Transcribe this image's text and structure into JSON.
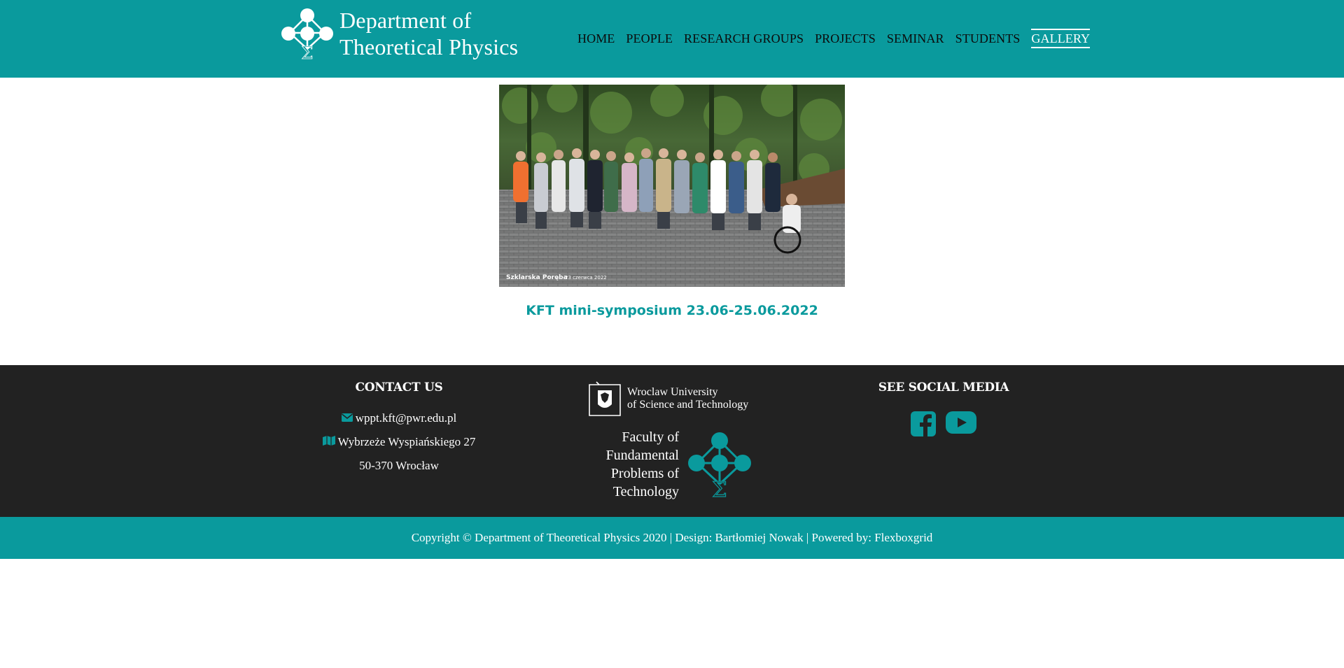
{
  "brand": {
    "line1": "Department of",
    "line2": "Theoretical Physics"
  },
  "nav": {
    "items": [
      {
        "label": "HOME"
      },
      {
        "label": "PEOPLE"
      },
      {
        "label": "RESEARCH GROUPS"
      },
      {
        "label": "PROJECTS"
      },
      {
        "label": "SEMINAR"
      },
      {
        "label": "STUDENTS"
      },
      {
        "label": "GALLERY"
      }
    ],
    "active": "GALLERY"
  },
  "gallery": {
    "photo_overlay_place": "Szklarska Poręba",
    "photo_overlay_date": "23 czerwca 2022",
    "caption": "KFT mini-symposium 23.06-25.06.2022"
  },
  "footer": {
    "contact_title": "CONTACT US",
    "email": "wppt.kft@pwr.edu.pl",
    "address_line1": "Wybrzeże Wyspiańskiego 27",
    "address_line2": "50-370 Wrocław",
    "university_line1": "Wroclaw University",
    "university_line2": "of Science and Technology",
    "faculty_line1": "Faculty of",
    "faculty_line2": "Fundamental",
    "faculty_line3": "Problems of",
    "faculty_line4": "Technology",
    "social_title": "SEE SOCIAL MEDIA",
    "social_icons": [
      "facebook-icon",
      "youtube-icon"
    ]
  },
  "copyright": {
    "text": "Copyright © Department of Theoretical Physics 2020 | Design: Bartłomiej Nowak | Powered by: Flexboxgrid"
  },
  "colors": {
    "brand_teal": "#0a9a9d",
    "footer_dark": "#222222",
    "nav_text": "#0b0b0b"
  }
}
